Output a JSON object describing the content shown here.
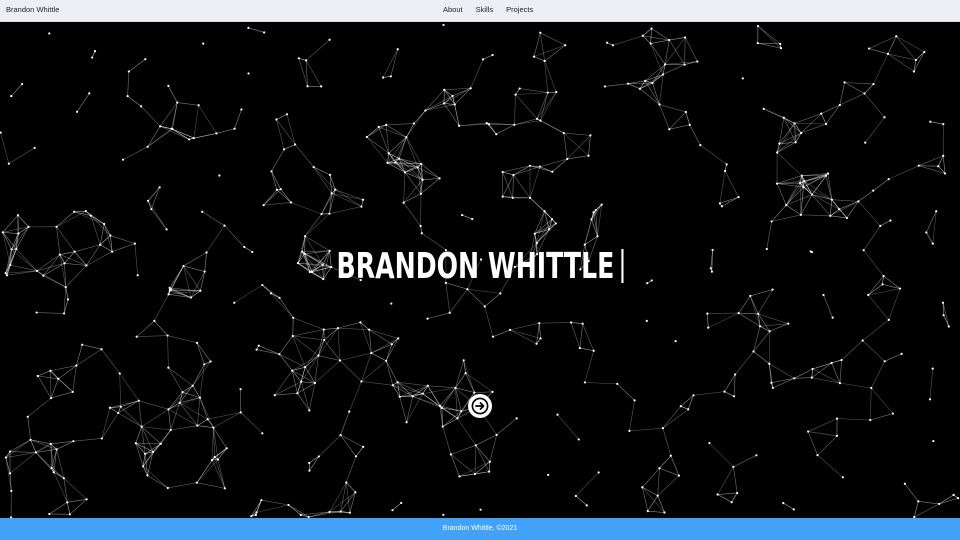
{
  "navbar": {
    "brand": "Brandon Whittle",
    "links": [
      "About",
      "Skills",
      "Projects"
    ]
  },
  "hero": {
    "title": "BRANDON WHITTLE",
    "next_icon": "arrow-right-icon",
    "background_color": "#000000",
    "particle_color": "#ffffff"
  },
  "footer": {
    "text": "Brandon Whittle, ©2021",
    "background_color": "#42a2f8"
  }
}
